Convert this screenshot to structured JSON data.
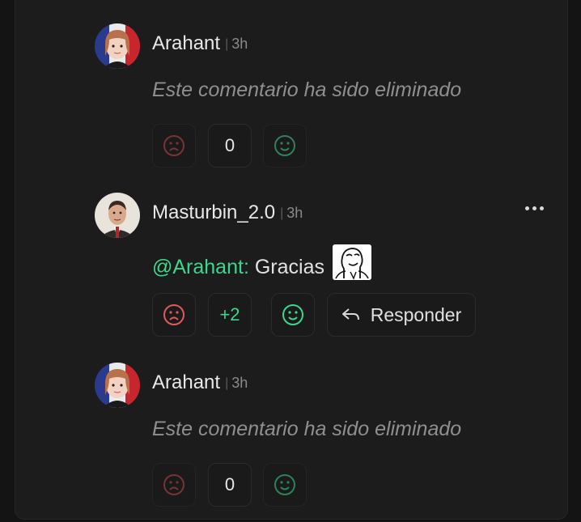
{
  "comments": [
    {
      "author": "Arahant",
      "time": "3h",
      "deleted_text": "Este comentario ha sido eliminado",
      "score": "0",
      "icons": [
        "sad-face-icon",
        "smile-face-icon"
      ]
    },
    {
      "author": "Masturbin_2.0",
      "time": "3h",
      "mention": "@Arahant:",
      "body": "Gracias",
      "score": "+2",
      "reply_label": "Responder",
      "icons": [
        "sad-face-icon",
        "smile-face-icon",
        "reply-arrow-icon",
        "more-options-icon",
        "meme-face-emote"
      ]
    },
    {
      "author": "Arahant",
      "time": "3h",
      "deleted_text": "Este comentario ha sido eliminado",
      "score": "0",
      "icons": [
        "sad-face-icon",
        "smile-face-icon"
      ]
    }
  ],
  "colors": {
    "background": "#141414",
    "panel": "#1c1c1c",
    "mention": "#3dd68c",
    "upvote": "#3dd68c",
    "downvote": "#e05a5a"
  }
}
